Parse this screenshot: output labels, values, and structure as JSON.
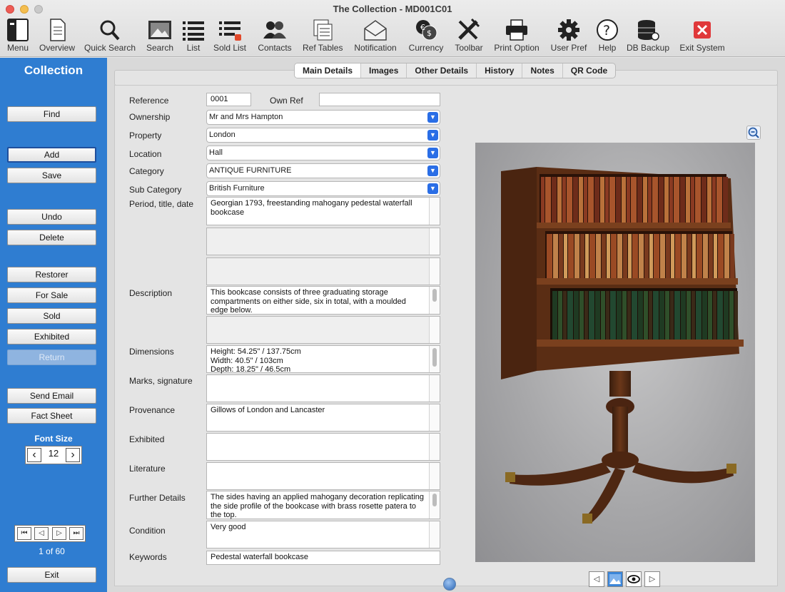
{
  "window": {
    "title": "The Collection - MD001C01"
  },
  "toolbar": [
    {
      "label": "Menu",
      "icon": "menu-icon"
    },
    {
      "label": "Overview",
      "icon": "overview-icon"
    },
    {
      "label": "Quick Search",
      "icon": "search-icon"
    },
    {
      "label": "Search",
      "icon": "image-search-icon"
    },
    {
      "label": "List",
      "icon": "list-icon"
    },
    {
      "label": "Sold List",
      "icon": "sold-list-icon"
    },
    {
      "label": "Contacts",
      "icon": "contacts-icon"
    },
    {
      "label": "Ref Tables",
      "icon": "ref-tables-icon"
    },
    {
      "label": "Notification",
      "icon": "envelope-icon"
    },
    {
      "label": "Currency",
      "icon": "currency-icon"
    },
    {
      "label": "Toolbar",
      "icon": "tools-icon"
    },
    {
      "label": "Print Option",
      "icon": "printer-icon"
    },
    {
      "label": "User Pref",
      "icon": "gear-icon"
    },
    {
      "label": "Help",
      "icon": "help-icon"
    },
    {
      "label": "DB Backup",
      "icon": "database-icon"
    },
    {
      "label": "Exit System",
      "icon": "exit-icon"
    }
  ],
  "sidebar": {
    "title": "Collection",
    "buttons": {
      "find": "Find",
      "add": "Add",
      "save": "Save",
      "undo": "Undo",
      "delete": "Delete",
      "restorer": "Restorer",
      "for_sale": "For Sale",
      "sold": "Sold",
      "exhibited": "Exhibited",
      "return": "Return",
      "send_email": "Send Email",
      "fact_sheet": "Fact Sheet",
      "exit": "Exit"
    },
    "font_size_label": "Font Size",
    "font_size": "12",
    "record_count": "1 of 60"
  },
  "tabs": [
    "Main Details",
    "Images",
    "Other Details",
    "History",
    "Notes",
    "QR Code"
  ],
  "active_tab": "Main Details",
  "form": {
    "reference_label": "Reference",
    "reference": "0001",
    "own_ref_label": "Own Ref",
    "own_ref": "",
    "ownership_label": "Ownership",
    "ownership": "Mr and Mrs Hampton",
    "property_label": "Property",
    "property": "London",
    "location_label": "Location",
    "location": "Hall",
    "category_label": "Category",
    "category": "ANTIQUE FURNITURE",
    "sub_category_label": "Sub Category",
    "sub_category": "British Furniture",
    "period_label": "Period, title, date",
    "period": "Georgian 1793, freestanding mahogany pedestal waterfall bookcase",
    "description_label": "Description",
    "description": "This bookcase consists of three graduating storage compartments on either side, six in total, with a moulded edge below.",
    "dimensions_label": "Dimensions",
    "dimensions": [
      "Height: 54.25\" / 137.75cm",
      "Width: 40.5\" / 103cm",
      "Depth: 18.25\" / 46.5cm"
    ],
    "marks_label": "Marks, signature",
    "marks": "",
    "provenance_label": "Provenance",
    "provenance": "Gillows of London and Lancaster",
    "exhibited_label": "Exhibited",
    "exhibited": "",
    "literature_label": "Literature",
    "literature": "",
    "further_label": "Further Details",
    "further": "The sides having an applied mahogany decoration replicating the side profile of the bookcase with brass rosette patera to the top.",
    "condition_label": "Condition",
    "condition": "Very good",
    "keywords_label": "Keywords",
    "keywords": "Pedestal waterfall bookcase"
  },
  "colors": {
    "sidebar": "#2f7dd1",
    "select_chevron": "#2a6ee6",
    "exit_red": "#e0383a"
  }
}
